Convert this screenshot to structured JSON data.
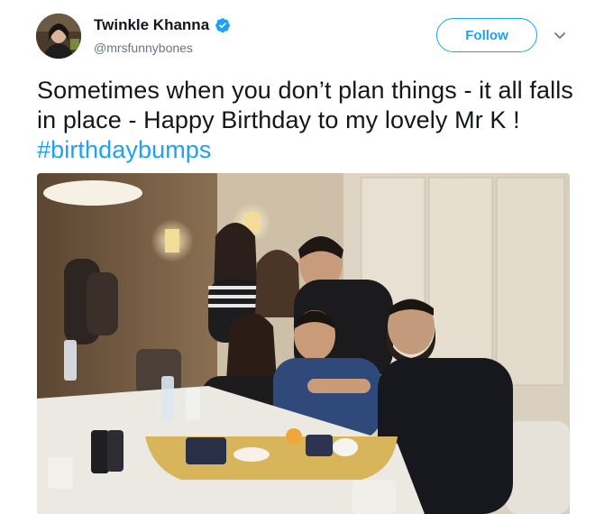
{
  "user": {
    "display_name": "Twinkle Khanna",
    "handle": "@mrsfunnybones",
    "verified": true,
    "avatar_icon": "profile-avatar"
  },
  "actions": {
    "follow_label": "Follow",
    "more_icon": "chevron-down-icon"
  },
  "tweet": {
    "text_before": "Sometimes when you don’t plan things - it all falls in place - Happy Birthday to my lovely Mr K ! ",
    "hashtag": "#birthdaybumps"
  },
  "colors": {
    "accent": "#1da1f2",
    "text": "#14171a",
    "secondary": "#657786"
  }
}
